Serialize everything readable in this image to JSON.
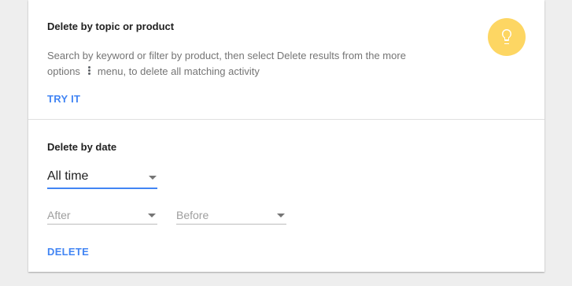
{
  "topic_section": {
    "title": "Delete by topic or product",
    "description_part1": "Search by keyword or filter by product, then select Delete results from the more",
    "description_part2_prefix": "options",
    "description_part2_suffix": "menu, to delete all matching activity",
    "try_button": "TRY IT",
    "tip_icon": "lightbulb-icon",
    "tip_icon_color": "#fdd663"
  },
  "date_section": {
    "title": "Delete by date",
    "range_select": {
      "value": "All time"
    },
    "after_field": {
      "placeholder": "After"
    },
    "before_field": {
      "placeholder": "Before"
    },
    "delete_button": "DELETE"
  },
  "colors": {
    "accent": "#4285f4",
    "card_background": "#ffffff",
    "page_background": "#eeeeee"
  }
}
